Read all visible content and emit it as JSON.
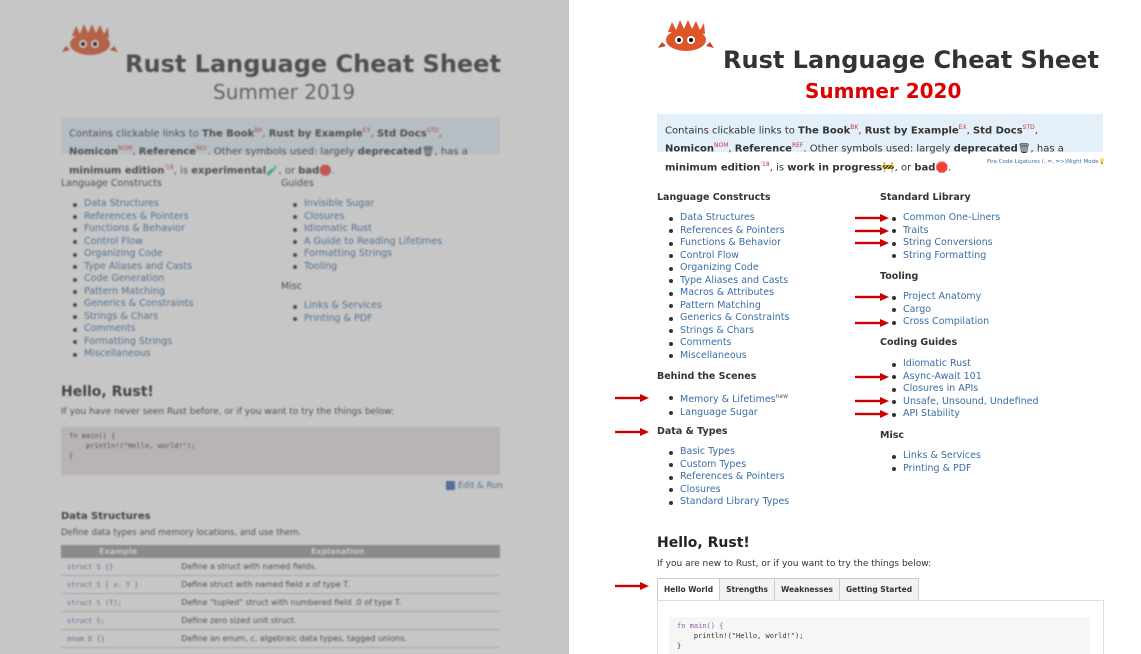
{
  "left": {
    "title": "Rust Language Cheat Sheet",
    "subtitle": "Summer 2019",
    "info": {
      "prefix": "Contains clickable links to ",
      "book": "The Book",
      "book_tag": "BK",
      "sep1": ", ",
      "rbe": "Rust by Example",
      "rbe_tag": "EX",
      "sep2": ", ",
      "std": "Std Docs",
      "std_tag": "STD",
      "sep3": ", ",
      "nomicon": "Nomicon",
      "nomicon_tag": "NOM",
      "sep4": ", ",
      "reference": "Reference",
      "reference_tag": "REF",
      "line2_prefix": ". Other symbols used: largely ",
      "deprecated": "deprecated",
      "has_a": ", has a ",
      "min_edition": "minimum edition",
      "edition_tag": "'18",
      "is": ", is ",
      "experimental": "experimental",
      "or": ", or ",
      "bad": "bad",
      "end": "."
    },
    "col1_heading": "Language Constructs",
    "col1_items": [
      "Data Structures",
      "References & Pointers",
      "Functions & Behavior",
      "Control Flow",
      "Organizing Code",
      "Type Aliases and Casts",
      "Code Generation",
      "Pattern Matching",
      "Generics & Constraints",
      "Strings & Chars",
      "Comments",
      "Formatting Strings",
      "Miscellaneous"
    ],
    "col2_heading": "Guides",
    "col2_items": [
      "Invisible Sugar",
      "Closures",
      "Idiomatic Rust",
      "A Guide to Reading Lifetimes",
      "Formatting Strings",
      "Tooling"
    ],
    "col3_heading": "Misc",
    "col3_items": [
      "Links & Services",
      "Printing & PDF"
    ],
    "hello_heading": "Hello, Rust!",
    "hello_text": "If you have never seen Rust before, or if you want to try the things below:",
    "code_line1": "fn main() {",
    "code_line2": "    println!(\"Hello, world!\");",
    "code_line3": "}",
    "edit_run": "Edit & Run",
    "ds_heading": "Data Structures",
    "ds_text": "Define data types and memory locations, and use them.",
    "table_headers": [
      "Example",
      "Explanation"
    ],
    "table_rows": [
      [
        "struct S {}",
        "Define a struct with named fields."
      ],
      [
        "struct S { x: T }",
        "Define struct with named field x of type T."
      ],
      [
        "struct S (T);",
        "Define \"tupled\" struct with numbered field .0 of type T."
      ],
      [
        "struct S;",
        "Define zero sized unit struct."
      ],
      [
        "enum E {}",
        "Define an enum, c. algebraic data types, tagged unions."
      ]
    ]
  },
  "right": {
    "title": "Rust Language Cheat Sheet",
    "subtitle": "Summer 2020",
    "subtitle_color": "#dd0000",
    "info": {
      "prefix": "Contains clickable links to ",
      "book": "The Book",
      "book_tag": "BK",
      "sep1": ", ",
      "rbe": "Rust by Example",
      "rbe_tag": "EX",
      "sep2": ", ",
      "std": "Std Docs",
      "std_tag": "STD",
      "sep3": ", ",
      "nomicon": "Nomicon",
      "nomicon_tag": "NOM",
      "sep4": ", ",
      "reference": "Reference",
      "reference_tag": "REF",
      "line2_prefix": ". Other symbols used: largely ",
      "deprecated": "deprecated",
      "has_a": ", has a ",
      "min_edition": "minimum edition",
      "edition_tag": "'18",
      "is": ", is ",
      "wip": "work in progress",
      "or": ", or ",
      "bad": "bad",
      "end": "."
    },
    "fira_link": "Fira Code Ligatures (..=, =>)",
    "night_link": "Night Mode",
    "lang_heading": "Language Constructs",
    "lang_items": [
      "Data Structures",
      "References & Pointers",
      "Functions & Behavior",
      "Control Flow",
      "Organizing Code",
      "Type Aliases and Casts",
      "Macros & Attributes",
      "Pattern Matching",
      "Generics & Constraints",
      "Strings & Chars",
      "Comments",
      "Miscellaneous"
    ],
    "bts_heading": "Behind the Scenes",
    "bts_items": [
      "Memory & Lifetimes",
      "Language Sugar"
    ],
    "bts_badge": "new",
    "dt_heading": "Data & Types",
    "dt_items": [
      "Basic Types",
      "Custom Types",
      "References & Pointers",
      "Closures",
      "Standard Library Types"
    ],
    "stdlib_heading": "Standard Library",
    "stdlib_items": [
      "Common One-Liners",
      "Traits",
      "String Conversions",
      "String Formatting"
    ],
    "tooling_heading": "Tooling",
    "tooling_items": [
      "Project Anatomy",
      "Cargo",
      "Cross Compilation"
    ],
    "guides_heading": "Coding Guides",
    "guides_items": [
      "Idiomatic Rust",
      "Async-Await 101",
      "Closures in APIs",
      "Unsafe, Unsound, Undefined",
      "API Stability"
    ],
    "misc_heading": "Misc",
    "misc_items": [
      "Links & Services",
      "Printing & PDF"
    ],
    "hello_heading": "Hello, Rust!",
    "hello_text": "If you are new to Rust, or if you want to try the things below:",
    "tabs": [
      "Hello World",
      "Strengths",
      "Weaknesses",
      "Getting Started"
    ],
    "code_line1": "fn main() {",
    "code_line2": "    println!(\"Hello, world!\");",
    "code_line3": "}"
  },
  "colors": {
    "arrow": "#cc0000",
    "link": "#3a6ea5",
    "info_bg": "#e3f0fa"
  }
}
